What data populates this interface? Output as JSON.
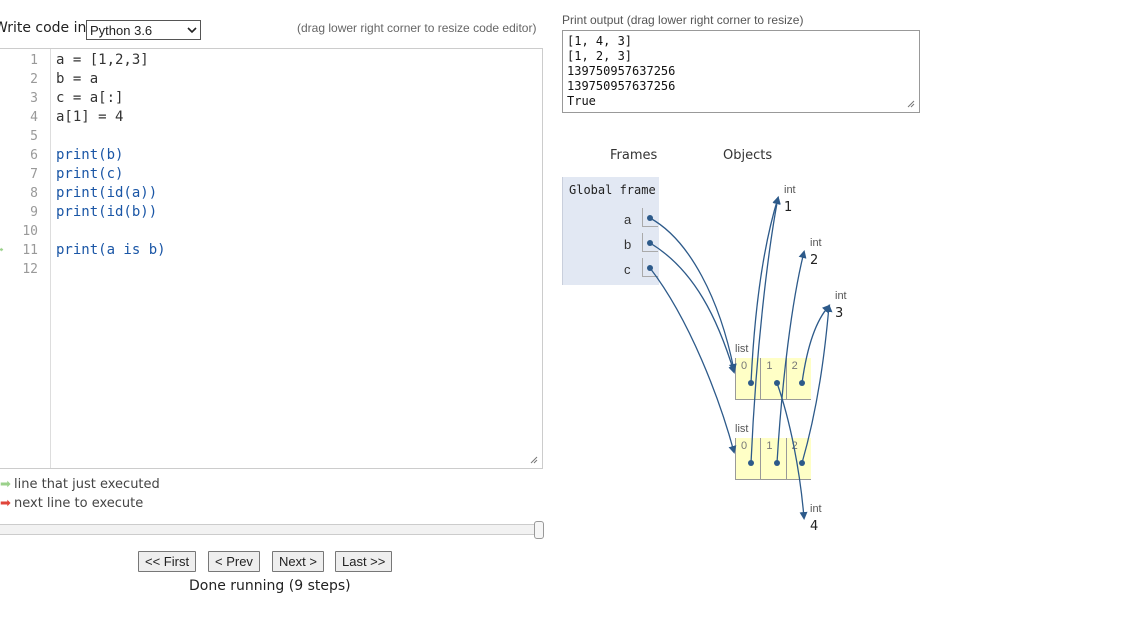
{
  "editor_header": {
    "write_label": "Write code in",
    "language": "Python 3.6",
    "drag_hint": "(drag lower right corner to resize code editor)"
  },
  "code_lines": [
    {
      "num": "1",
      "text": "a = [1,2,3]"
    },
    {
      "num": "2",
      "text": "b = a"
    },
    {
      "num": "3",
      "text": "c = a[:]"
    },
    {
      "num": "4",
      "text": "a[1] = 4"
    },
    {
      "num": "5",
      "text": ""
    },
    {
      "num": "6",
      "text": "print(b)"
    },
    {
      "num": "7",
      "text": "print(c)"
    },
    {
      "num": "8",
      "text": "print(id(a))"
    },
    {
      "num": "9",
      "text": "print(id(b))"
    },
    {
      "num": "10",
      "text": ""
    },
    {
      "num": "11",
      "text": "print(a is b)"
    },
    {
      "num": "12",
      "text": ""
    }
  ],
  "legend": {
    "just_executed": "line that just executed",
    "next_to_execute": "next line to execute",
    "just_executed_color": "#9bd18b",
    "next_color": "#e0453a"
  },
  "nav": {
    "first": "<< First",
    "prev": "< Prev",
    "next": "Next >",
    "last": "Last >>",
    "status": "Done running (9 steps)"
  },
  "slider": {
    "position_fraction": 1.0
  },
  "print_output": {
    "label": "Print output (drag lower right corner to resize)",
    "lines": [
      "[1, 4, 3]",
      "[1, 2, 3]",
      "139750957637256",
      "139750957637256",
      "True"
    ]
  },
  "visualizer": {
    "frames_header": "Frames",
    "objects_header": "Objects",
    "global_frame": {
      "title": "Global frame",
      "vars": [
        "a",
        "b",
        "c"
      ]
    },
    "ints": [
      {
        "type": "int",
        "value": "1"
      },
      {
        "type": "int",
        "value": "2"
      },
      {
        "type": "int",
        "value": "3"
      },
      {
        "type": "int",
        "value": "4"
      }
    ],
    "lists": [
      {
        "type": "list",
        "indices": [
          "0",
          "1",
          "2"
        ]
      },
      {
        "type": "list",
        "indices": [
          "0",
          "1",
          "2"
        ]
      }
    ],
    "arrow_color": "#2d5a8a",
    "frame_bg": "#e2e8f3",
    "list_bg": "#ffffc6"
  }
}
